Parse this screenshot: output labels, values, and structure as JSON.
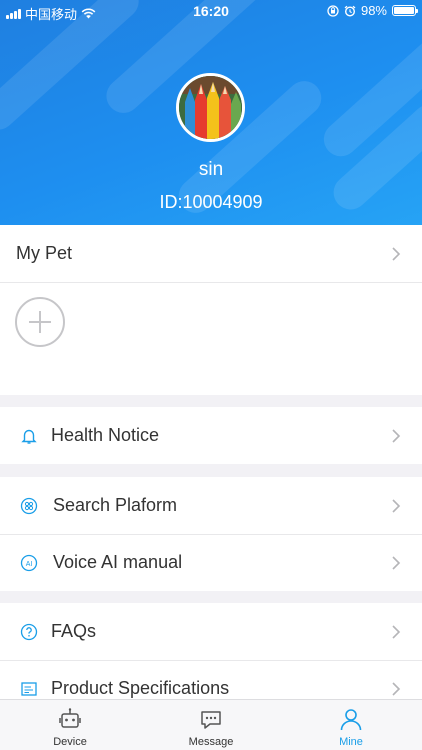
{
  "status_bar": {
    "carrier": "中国移动",
    "time": "16:20",
    "battery": "98%",
    "battery_level": 0.98,
    "icons": [
      "signal-icon",
      "wifi-icon",
      "orientation-lock-icon",
      "alarm-icon",
      "battery-icon"
    ]
  },
  "profile": {
    "username": "sin",
    "id_text": "ID:10004909",
    "avatar_icon": "colored-pencils-avatar"
  },
  "my_pet": {
    "label": "My Pet",
    "add_icon": "add-circle-icon"
  },
  "menu": {
    "health_notice": "Health Notice",
    "search_platform": "Search Plaform",
    "voice_ai": "Voice AI manual",
    "faqs": "FAQs",
    "product_specs": "Product Specifications"
  },
  "tabbar": {
    "device": "Device",
    "message": "Message",
    "mine": "Mine",
    "active": "mine"
  },
  "colors": {
    "header_blue": "#1e8ff0",
    "accent": "#1a9ee8",
    "text": "#333333",
    "chevron": "#b5b5b8",
    "divider": "#e8e8ea",
    "page_bg": "#f2f1f5"
  }
}
